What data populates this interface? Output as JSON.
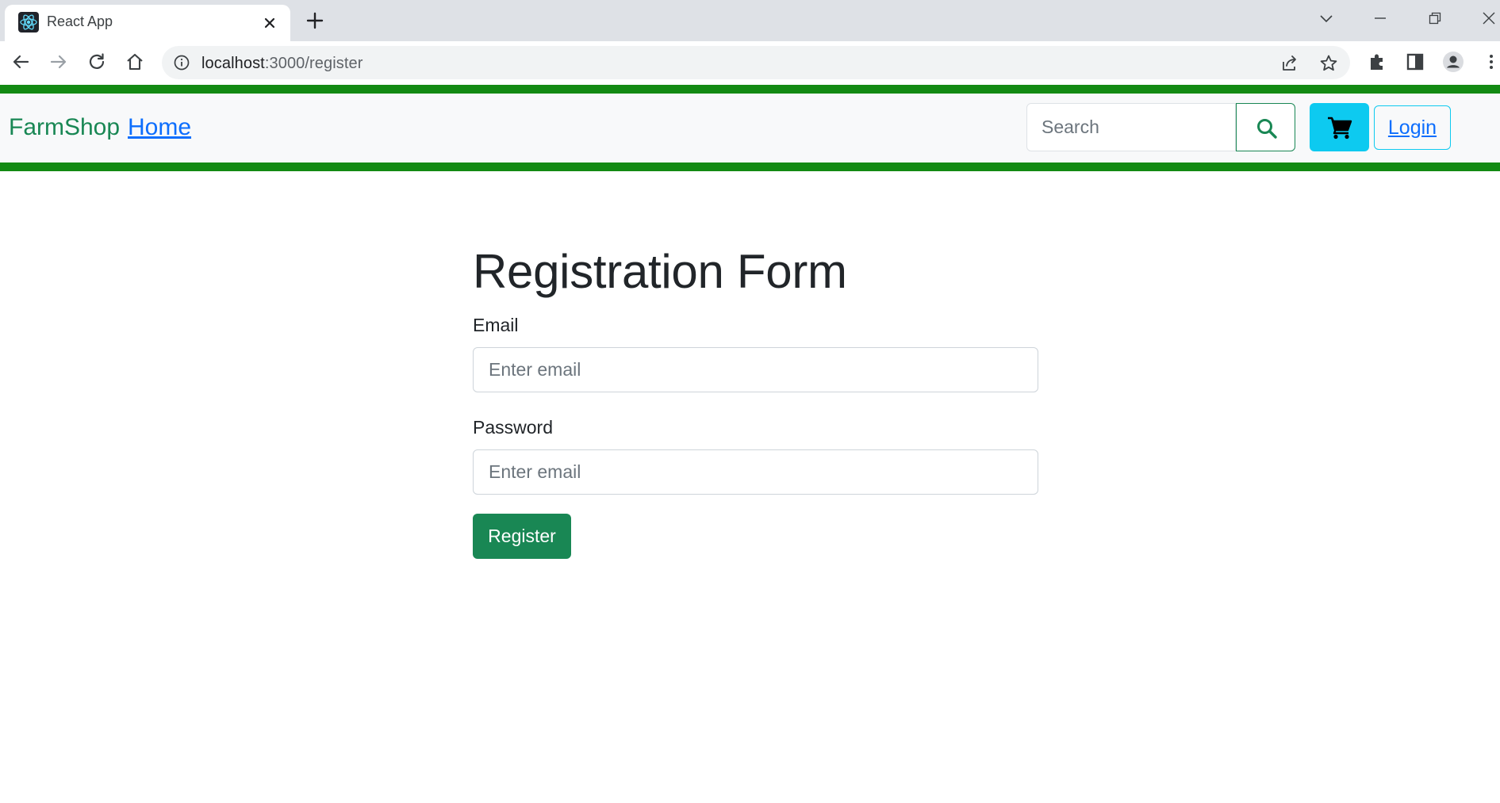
{
  "browser": {
    "tab_title": "React App",
    "url_host": "localhost",
    "url_rest": ":3000/register",
    "icons": {
      "favicon": "react-logo-icon",
      "tab_close": "close-icon",
      "new_tab": "plus-icon",
      "tab_search": "chevron-down-icon",
      "minimize": "minimize-icon",
      "restore": "restore-icon",
      "close_window": "close-icon",
      "back": "back-arrow-icon",
      "forward": "forward-arrow-icon",
      "reload": "reload-icon",
      "home": "home-icon",
      "site_info": "info-icon",
      "share": "share-icon",
      "bookmark": "star-icon",
      "extensions": "puzzle-icon",
      "side_panel": "side-panel-icon",
      "profile": "profile-icon",
      "menu": "kebab-menu-icon"
    }
  },
  "navbar": {
    "brand": "FarmShop",
    "home_link": "Home",
    "search_placeholder": "Search",
    "search_icon": "search-icon",
    "cart_icon": "cart-icon",
    "login_label": "Login"
  },
  "form": {
    "title": "Registration Form",
    "email_label": "Email",
    "email_placeholder": "Enter email",
    "password_label": "Password",
    "password_placeholder": "Enter email",
    "register_label": "Register"
  },
  "colors": {
    "accent_green_bar": "#138a13",
    "brand_green": "#198754",
    "cart_cyan": "#0dcaf0",
    "link_blue": "#0d6efd"
  }
}
